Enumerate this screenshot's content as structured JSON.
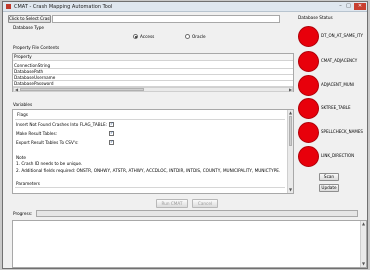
{
  "window": {
    "title": "CMAT - Crash Mapping Automation Tool",
    "min_glyph": "–",
    "max_glyph": "□",
    "close_glyph": "✕"
  },
  "file": {
    "select_button": "Click to Select Crash File...",
    "path_value": ""
  },
  "database_type": {
    "label": "Database Type",
    "options": [
      "Access",
      "Oracle"
    ],
    "selected": "Access"
  },
  "property_file": {
    "header": "Property File Contents",
    "column": "Property",
    "rows": [
      "ConnectionString",
      "DatabasePath",
      "DatabaseUsername",
      "DatabasePassword"
    ]
  },
  "variables": {
    "header": "Variables",
    "flags_header": "Flags",
    "flags": [
      {
        "label": "Insert Not Found Crashes Into FLAG_TABLE:",
        "checked": true
      },
      {
        "label": "Make Result Tables:",
        "checked": true
      },
      {
        "label": "Export Result Tables To CSV's:",
        "checked": true
      }
    ],
    "note_header": "Note",
    "notes": [
      "1. Crash ID needs to be unique.",
      "2. Additional fields required: ONSTR, ONHWY, ATSTR, ATHWY, ACCDLOC, INTDIR, INTDIS, COUNTY, MUNICIPALITY, MUNICTYPE."
    ],
    "parameters_header": "Parameters"
  },
  "actions": {
    "run": "Run CMAT",
    "cancel": "Cancel"
  },
  "database_status": {
    "header": "Database Status",
    "items": [
      "DT_ON_AT_SAME_ITY",
      "CMAT_ADJACENCY",
      "ADJACENT_MUNI",
      "SKTREE_TABLE",
      "SPELLCHECK_NAMES",
      "LINK_DIRECTION"
    ],
    "status_color": "#e8000b",
    "scan_button": "Scan",
    "update_button": "Update"
  },
  "progress": {
    "label": "Progress:",
    "value": 0
  }
}
